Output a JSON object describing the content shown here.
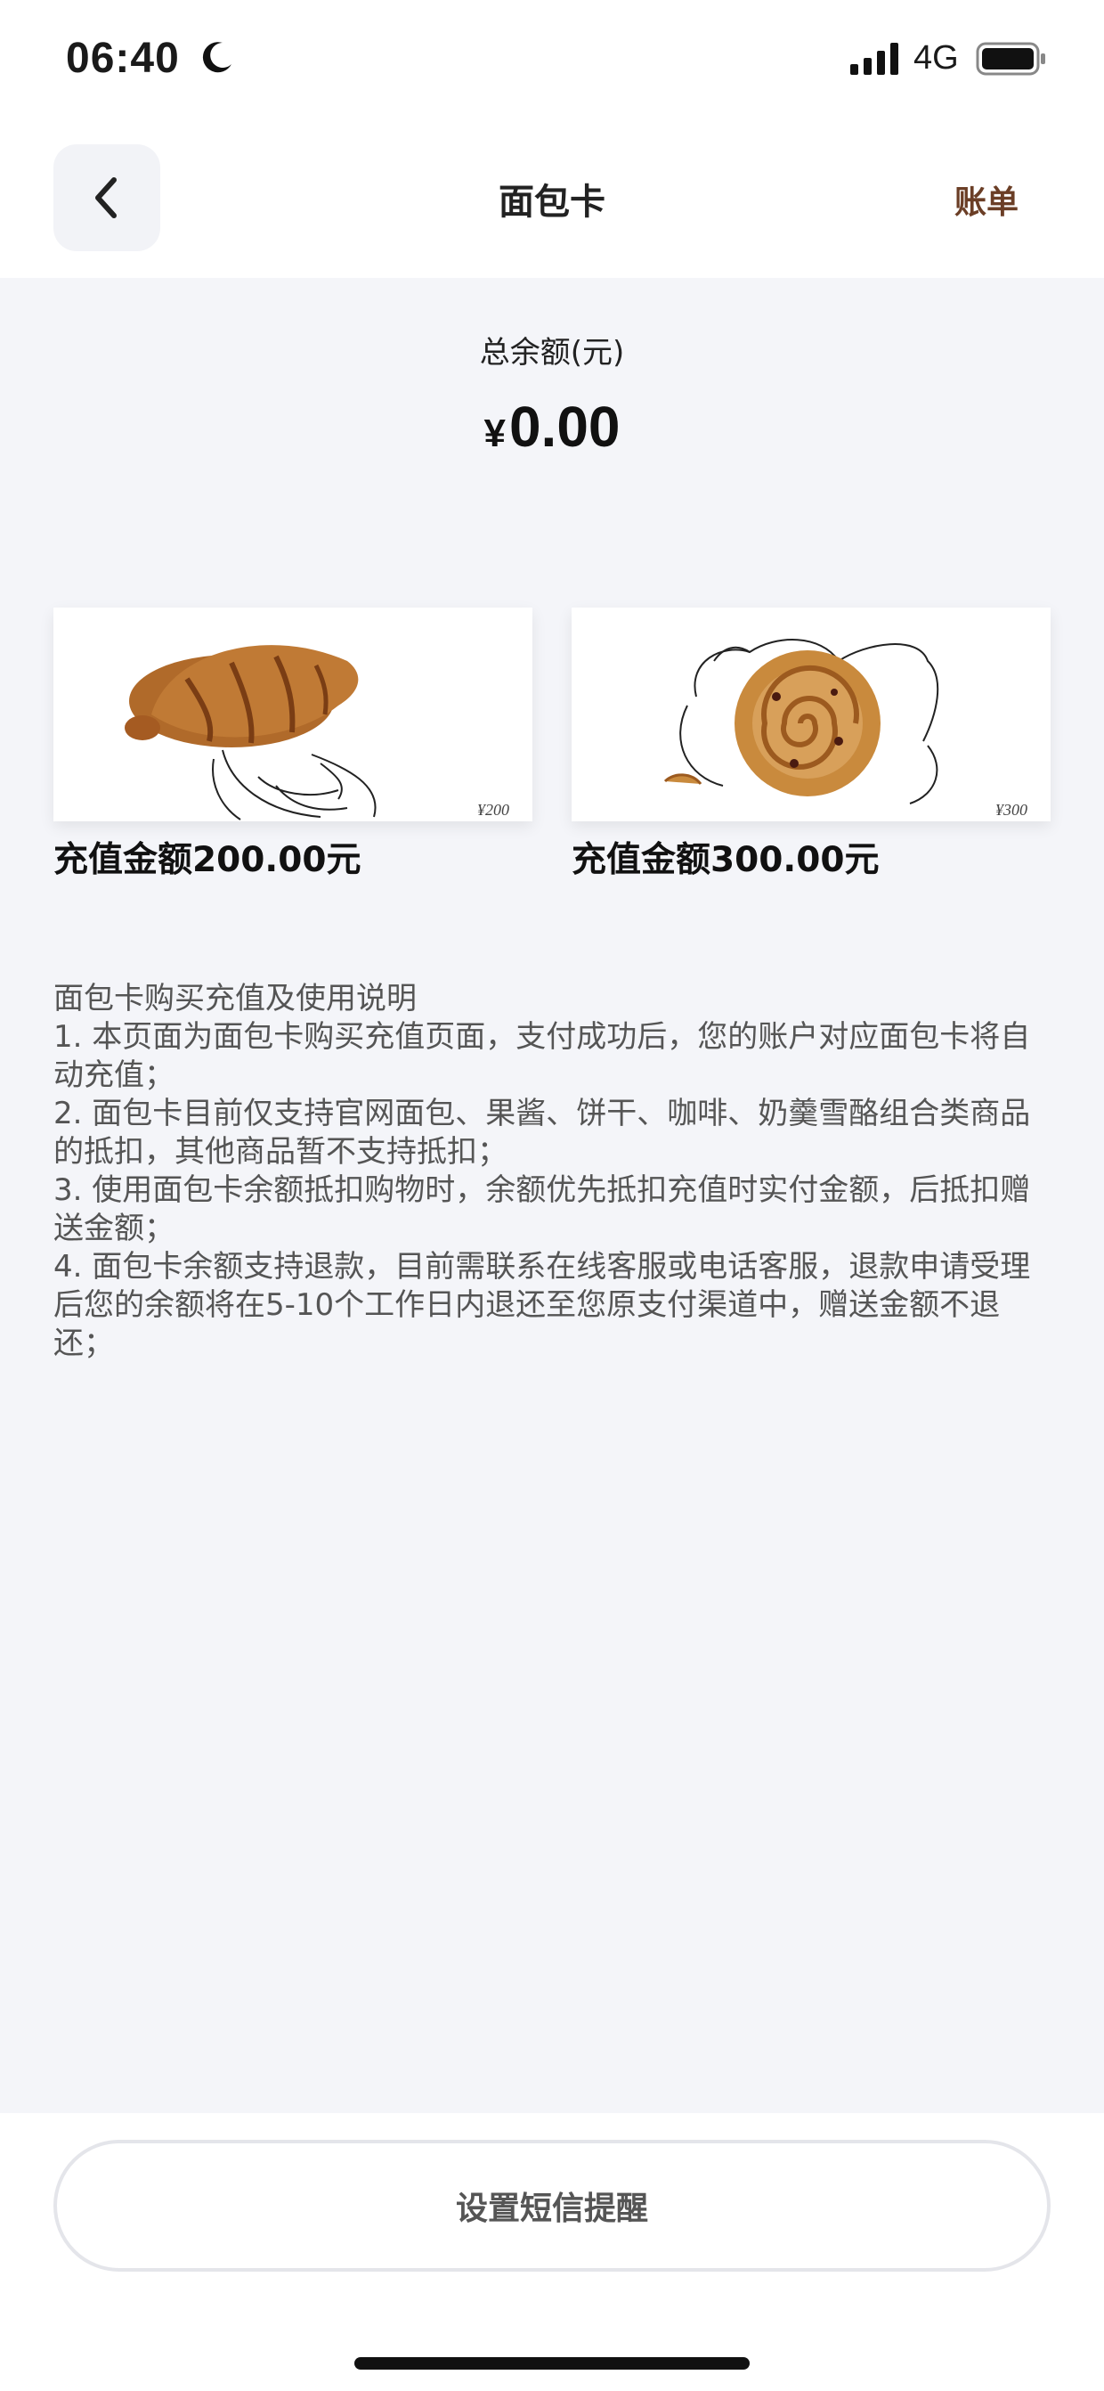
{
  "status_bar": {
    "time": "06:40",
    "network": "4G",
    "icons": [
      "moon-icon",
      "signal-icon",
      "battery-icon"
    ]
  },
  "nav": {
    "back_icon": "chevron-left-icon",
    "title": "面包卡",
    "bill_label": "账单"
  },
  "balance": {
    "label": "总余额(元)",
    "currency": "¥",
    "amount": "0.00"
  },
  "cards": [
    {
      "label": "充值金额200.00元",
      "price_tag": "¥200",
      "image": "croissant"
    },
    {
      "label": "充值金额300.00元",
      "price_tag": "¥300",
      "image": "cinnamon-roll"
    }
  ],
  "instructions": {
    "title": "面包卡购买充值及使用说明",
    "items": [
      "1. 本页面为面包卡购买充值页面，支付成功后，您的账户对应面包卡将自动充值；",
      "2. 面包卡目前仅支持官网面包、果酱、饼干、咖啡、奶羹雪酪组合类商品的抵扣，其他商品暂不支持抵扣；",
      "3. 使用面包卡余额抵扣购物时，余额优先抵扣充值时实付金额，后抵扣赠送金额；",
      "4. 面包卡余额支持退款，目前需联系在线客服或电话客服，退款申请受理后您的余额将在5-10个工作日内退还至您原支付渠道中，赠送金额不退还；"
    ]
  },
  "bottom": {
    "sms_button_label": "设置短信提醒"
  },
  "colors": {
    "accent": "#6b3e26",
    "page_bg": "#f4f5f9",
    "text_secondary": "#555555"
  }
}
